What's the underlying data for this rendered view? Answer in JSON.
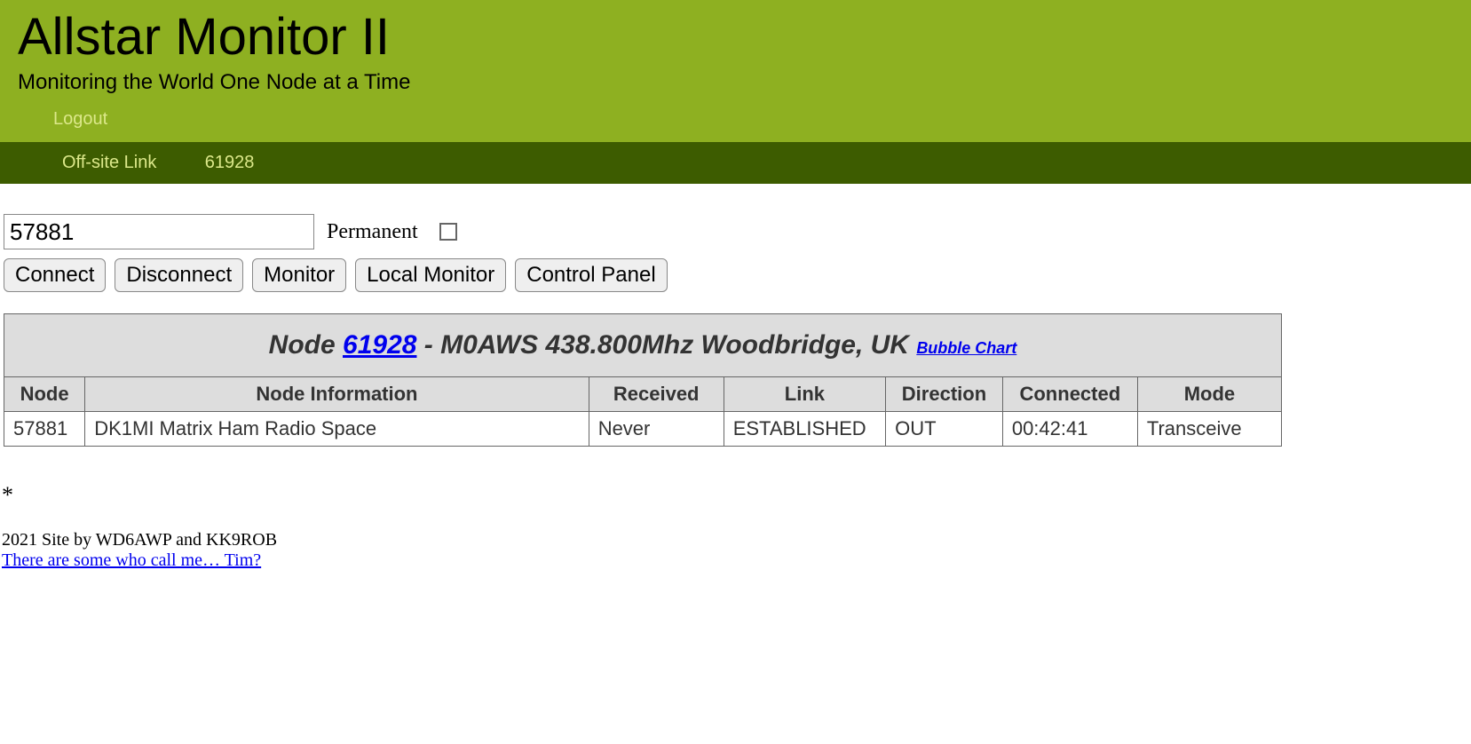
{
  "header": {
    "title": "Allstar Monitor II",
    "subtitle": "Monitoring the World One Node at a Time",
    "logout": "Logout"
  },
  "navbar": {
    "offsite": "Off-site Link",
    "node": "61928"
  },
  "controls": {
    "node_input_value": "57881",
    "permanent_label": "Permanent",
    "buttons": {
      "connect": "Connect",
      "disconnect": "Disconnect",
      "monitor": "Monitor",
      "local_monitor": "Local Monitor",
      "control_panel": "Control Panel"
    }
  },
  "table": {
    "title_prefix": "Node ",
    "title_node": "61928",
    "title_suffix": " - M0AWS 438.800Mhz Woodbridge, UK ",
    "bubble_chart": "Bubble Chart",
    "headers": {
      "node": "Node",
      "info": "Node Information",
      "received": "Received",
      "link": "Link",
      "direction": "Direction",
      "connected": "Connected",
      "mode": "Mode"
    },
    "rows": [
      {
        "node": "57881",
        "info": "DK1MI Matrix Ham Radio Space",
        "received": "Never",
        "link": "ESTABLISHED",
        "direction": "OUT",
        "connected": "00:42:41",
        "mode": "Transceive"
      }
    ]
  },
  "footer": {
    "asterisk": "*",
    "credits": "2021 Site by WD6AWP and KK9ROB",
    "tim_link": "There are some who call me… Tim?"
  }
}
